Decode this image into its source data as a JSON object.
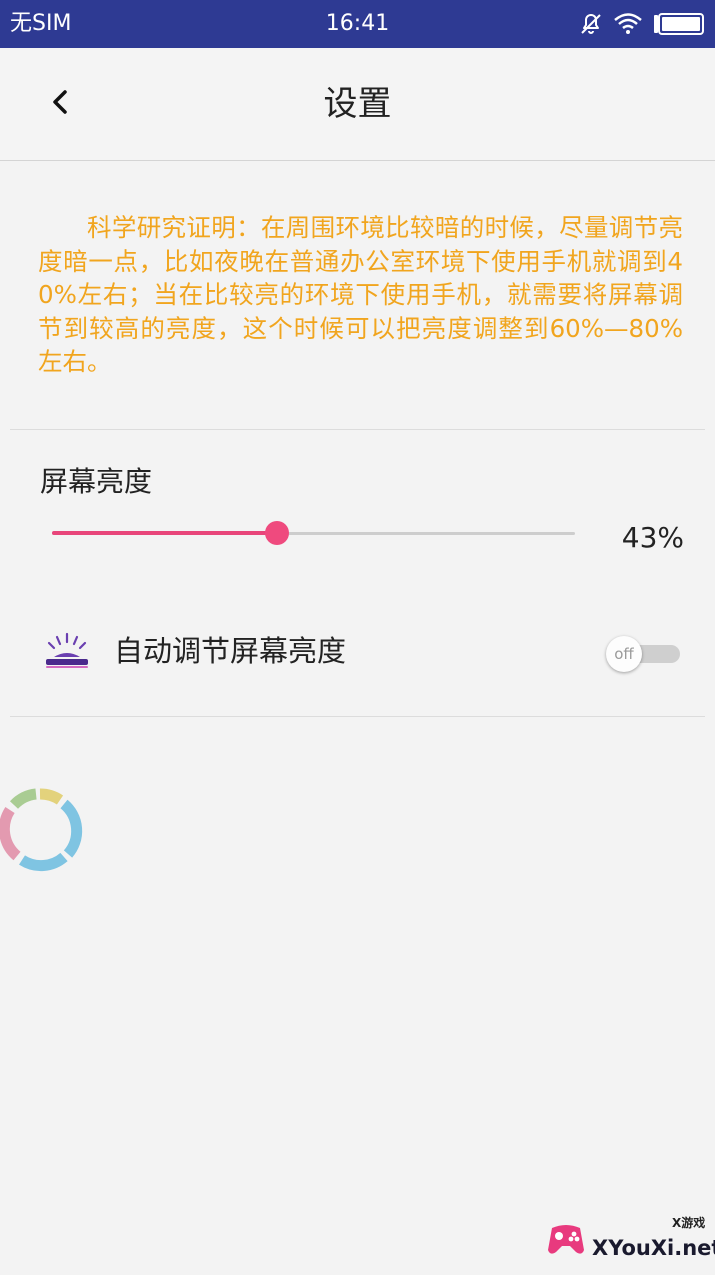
{
  "status_bar": {
    "carrier": "无SIM",
    "time": "16:41",
    "icons": [
      "bell-off-icon",
      "wifi-icon",
      "battery-icon"
    ],
    "background_color": "#2e3a93"
  },
  "header": {
    "title": "设置",
    "back_icon": "chevron-left-icon"
  },
  "tip": {
    "text": "科学研究证明：在周围环境比较暗的时候，尽量调节亮度暗一点，比如夜晚在普通办公室环境下使用手机就调到40%左右；当在比较亮的环境下使用手机，就需要将屏幕调节到较高的亮度，这个时候可以把亮度调整到60%—80%左右。",
    "color": "#f1a51e"
  },
  "brightness": {
    "label": "屏幕亮度",
    "value": 43,
    "value_text": "43%",
    "accent_color": "#e8457a"
  },
  "auto_brightness": {
    "label": "自动调节屏幕亮度",
    "icon": "brightness-lamp-icon",
    "toggle_text": "off",
    "enabled": false
  },
  "loading": {
    "icon": "loading-spinner-icon"
  },
  "watermark": {
    "small_text": "X游戏",
    "site": "XYouXi.net",
    "logo": "gamepad-logo-icon"
  }
}
